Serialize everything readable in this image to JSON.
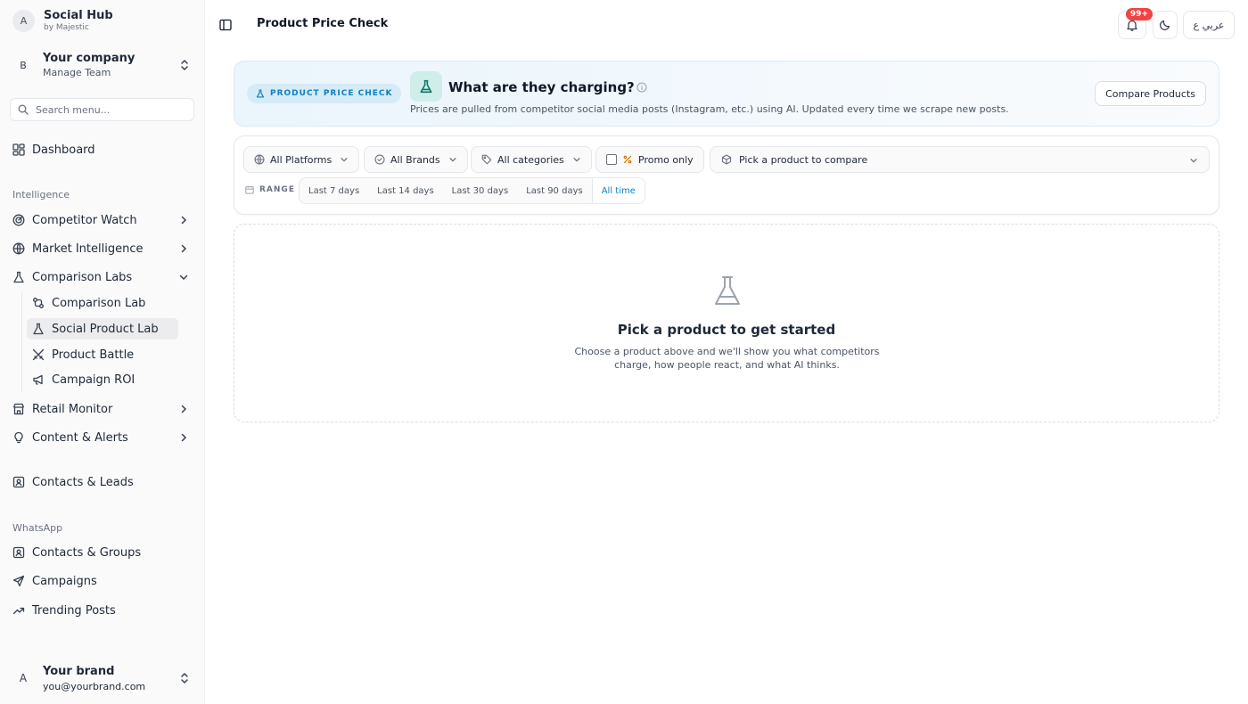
{
  "app": {
    "name": "Social Hub",
    "by": "by Majestic",
    "avatar_letter": "A"
  },
  "company": {
    "letter": "B",
    "name": "Your company",
    "sub": "Manage Team"
  },
  "search": {
    "placeholder": "Search menu..."
  },
  "nav": {
    "dashboard": "Dashboard",
    "intelligence_label": "Intelligence",
    "competitor_watch": "Competitor Watch",
    "market_intelligence": "Market Intelligence",
    "comparison_labs": "Comparison Labs",
    "sub": {
      "comparison_lab": "Comparison Lab",
      "social_product_lab": "Social Product Lab",
      "product_battle": "Product Battle",
      "campaign_roi": "Campaign ROI"
    },
    "retail_monitor": "Retail Monitor",
    "content_alerts": "Content & Alerts",
    "contacts_leads": "Contacts & Leads",
    "whatsapp_label": "WhatsApp",
    "contacts_groups": "Contacts & Groups",
    "campaigns": "Campaigns",
    "trending_posts": "Trending Posts"
  },
  "user": {
    "letter": "A",
    "name": "Your brand",
    "email": "you@yourbrand.com"
  },
  "header": {
    "title": "Product Price Check",
    "notifications_badge": "99+",
    "language": "عربي ع"
  },
  "hero": {
    "pill": "PRODUCT PRICE CHECK",
    "heading": "What are they charging?",
    "description": "Prices are pulled from competitor social media posts (Instagram, etc.) using AI. Updated every time we scrape new posts.",
    "compare_button": "Compare Products",
    "accent_color": "#0e7fc0"
  },
  "filters": {
    "platforms": "All Platforms",
    "brands": "All Brands",
    "categories": "All categories",
    "promo": "Promo only",
    "product_picker": "Pick a product to compare",
    "range_label": "RANGE",
    "range_options": [
      "Last 7 days",
      "Last 14 days",
      "Last 30 days",
      "Last 90 days",
      "All time"
    ],
    "range_selected": "All time"
  },
  "empty_state": {
    "title": "Pick a product to get started",
    "description": "Choose a product above and we'll show you what competitors charge, how people react, and what AI thinks."
  }
}
